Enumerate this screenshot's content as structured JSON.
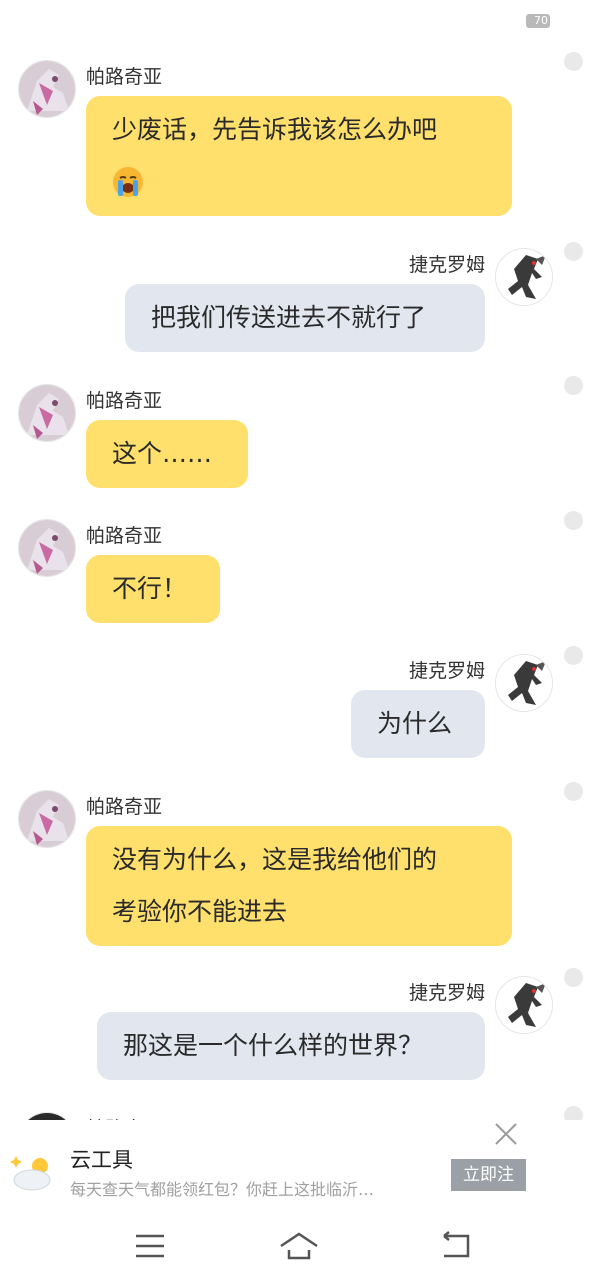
{
  "status_bar": {
    "battery": "70"
  },
  "messages": [
    {
      "side": "left",
      "sender": "帕路奇亚",
      "lines": [
        "少废话，先告诉我该怎么办吧"
      ],
      "emoji": "😭"
    },
    {
      "side": "right",
      "sender": "捷克罗姆",
      "lines": [
        "把我们传送进去不就行了"
      ]
    },
    {
      "side": "left",
      "sender": "帕路奇亚",
      "lines": [
        "这个……"
      ]
    },
    {
      "side": "left",
      "sender": "帕路奇亚",
      "lines": [
        "不行！"
      ]
    },
    {
      "side": "right",
      "sender": "捷克罗姆",
      "lines": [
        "为什么"
      ]
    },
    {
      "side": "left",
      "sender": "帕路奇亚",
      "lines": [
        "没有为什么，这是我给他们的",
        "考验你不能进去"
      ]
    },
    {
      "side": "right",
      "sender": "捷克罗姆",
      "lines": [
        "那这是一个什么样的世界？"
      ]
    },
    {
      "side": "left",
      "sender": "帕路奇亚"
    }
  ],
  "ad": {
    "title": "云工具",
    "description": "每天查天气都能领红包？你赶上这批临沂…",
    "button_label": "立即注"
  },
  "icons": {
    "ad_icon": "weather-sun-cloud-icon",
    "close": "close-icon",
    "nav_menu": "menu-icon",
    "nav_home": "home-icon",
    "nav_back": "back-icon"
  },
  "colors": {
    "left_bubble": "#ffe06d",
    "right_bubble": "#e2e7ef",
    "background": "#ffffff"
  }
}
